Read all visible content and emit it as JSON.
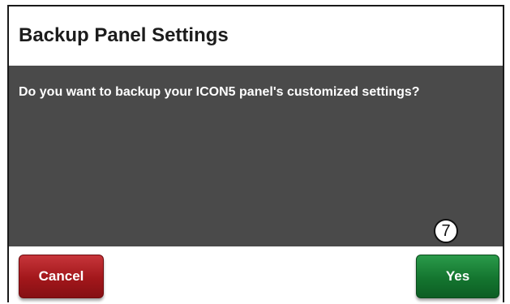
{
  "dialog": {
    "title": "Backup Panel Settings",
    "message": "Do you want to backup your ICON5 panel's customized settings?"
  },
  "buttons": {
    "cancel_label": "Cancel",
    "yes_label": "Yes"
  },
  "callout": {
    "number": "7"
  },
  "colors": {
    "message_background": "#4a4a4a",
    "cancel_button": "#a2171b",
    "yes_button": "#14752f"
  }
}
